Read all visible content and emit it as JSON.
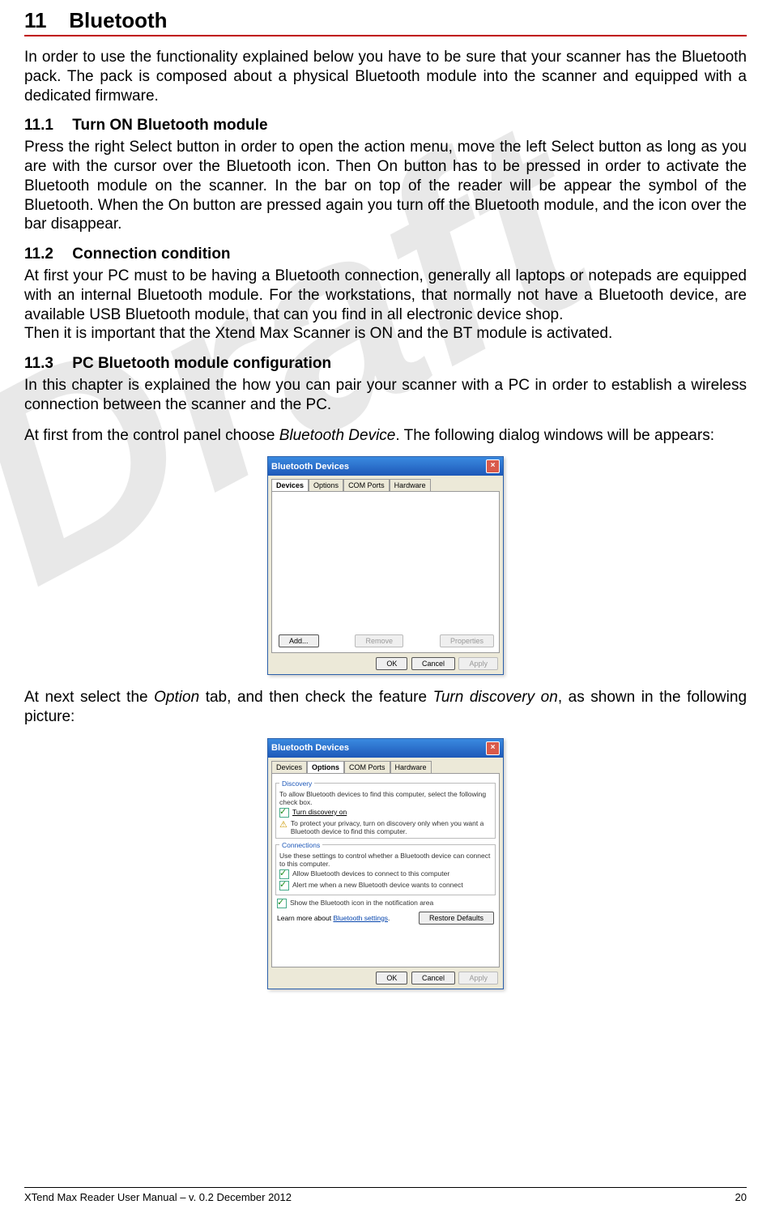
{
  "watermark": "Draft",
  "chapter": {
    "number": "11",
    "title": "Bluetooth"
  },
  "intro": "In order to use the functionality explained below you have to be sure that your scanner has the Bluetooth pack. The pack is composed about a physical Bluetooth module into the scanner and equipped with a dedicated firmware.",
  "s1": {
    "num": "11.1",
    "title": "Turn ON Bluetooth module",
    "body": "Press the right Select button in order to open the action menu, move the left Select button as long as you are with the cursor over the Bluetooth icon. Then On button has to be pressed in order to activate the Bluetooth module on the scanner. In the bar on top of the reader will be appear the symbol of the Bluetooth. When the On button are pressed again you turn off the Bluetooth module, and the icon over the bar disappear."
  },
  "s2": {
    "num": "11.2",
    "title": "Connection condition",
    "body1": "At first your PC must to be having a Bluetooth connection, generally all laptops or notepads are equipped with an internal Bluetooth module. For the workstations, that normally not have a Bluetooth device, are available USB Bluetooth module, that can you find in all electronic device shop.",
    "body2": "Then it is important that the Xtend Max Scanner is ON and the BT module is activated."
  },
  "s3": {
    "num": "11.3",
    "title": "PC Bluetooth module configuration",
    "body1": "In this chapter is explained the how you can pair your scanner with a PC in order to establish a wireless connection between the scanner and the PC.",
    "body2a": "At first from the control panel choose ",
    "body2_italic": "Bluetooth Device",
    "body2b": ". The following dialog windows will be appears:",
    "body3a": "At next select the ",
    "body3_i1": "Option",
    "body3b": " tab, and then check the feature ",
    "body3_i2": "Turn discovery on",
    "body3c": ", as shown in the following picture:"
  },
  "dialog1": {
    "title": "Bluetooth Devices",
    "tabs": [
      "Devices",
      "Options",
      "COM Ports",
      "Hardware"
    ],
    "activeTab": 0,
    "buttons": {
      "add": "Add...",
      "remove": "Remove",
      "properties": "Properties"
    },
    "bottom": {
      "ok": "OK",
      "cancel": "Cancel",
      "apply": "Apply"
    }
  },
  "dialog2": {
    "title": "Bluetooth Devices",
    "tabs": [
      "Devices",
      "Options",
      "COM Ports",
      "Hardware"
    ],
    "activeTab": 1,
    "discovery": {
      "legend": "Discovery",
      "text": "To allow Bluetooth devices to find this computer, select the following check box.",
      "check": "Turn discovery on",
      "warn": "To protect your privacy, turn on discovery only when you want a Bluetooth device to find this computer."
    },
    "connections": {
      "legend": "Connections",
      "text": "Use these settings to control whether a Bluetooth device can connect to this computer.",
      "c1": "Allow Bluetooth devices to connect to this computer",
      "c2": "Alert me when a new Bluetooth device wants to connect"
    },
    "showIcon": "Show the Bluetooth icon in the notification area",
    "learnMore": "Learn more about ",
    "learnLink": "Bluetooth settings",
    "restore": "Restore Defaults",
    "bottom": {
      "ok": "OK",
      "cancel": "Cancel",
      "apply": "Apply"
    }
  },
  "footer": {
    "left": "XTend Max Reader User Manual – v. 0.2 December 2012",
    "right": "20"
  }
}
